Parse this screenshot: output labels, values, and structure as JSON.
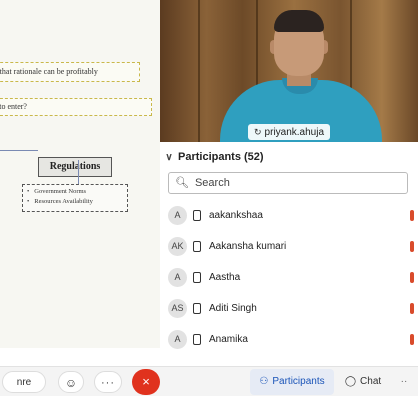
{
  "slide": {
    "line1": "f that rationale can be profitably",
    "line2": "l to enter?",
    "regulations_title": "Regulations",
    "regulations_items": [
      "Government Norms",
      "Resources Availability"
    ]
  },
  "video": {
    "participant_name": "priyank.ahuja"
  },
  "participants": {
    "header": "Participants (52)",
    "search_placeholder": "Search",
    "items": [
      {
        "initials": "A",
        "name": "aakankshaa"
      },
      {
        "initials": "AK",
        "name": "Aakansha kumari"
      },
      {
        "initials": "A",
        "name": "Aastha"
      },
      {
        "initials": "AS",
        "name": "Aditi Singh"
      },
      {
        "initials": "A",
        "name": "Anamika"
      }
    ]
  },
  "toolbar": {
    "share_label": "nre",
    "more_label": "···",
    "end_label": "×",
    "participants_label": "Participants",
    "chat_label": "Chat",
    "extra_label": "··"
  },
  "colors": {
    "end_call": "#e0321e",
    "active_tab": "#1a54b8",
    "mic_muted": "#d94b2b",
    "shirt": "#2f9fbf"
  }
}
